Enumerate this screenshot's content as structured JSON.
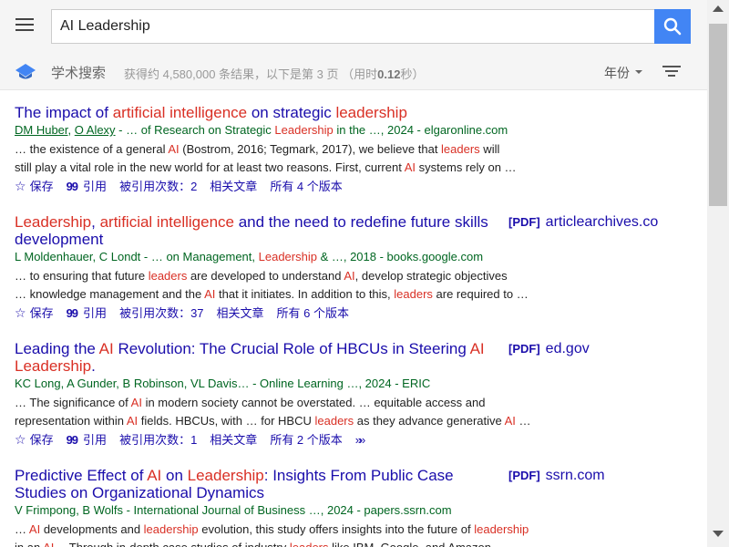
{
  "search": {
    "query": "AI Leadership"
  },
  "subbar": {
    "scholar_label": "学术搜索",
    "stats_prefix": "获得约 4,580,000 条结果，以下是第 3 页 （用时",
    "stats_time": "0.12",
    "stats_suffix": "秒）",
    "year_filter": "年份"
  },
  "colors": {
    "accent": "#4285f4",
    "title_link": "#1a0dab",
    "highlight": "#d93025",
    "meta_green": "#006621"
  },
  "results": [
    {
      "title": [
        {
          "t": "The impact of ",
          "h": false
        },
        {
          "t": "artificial intelligence",
          "h": true
        },
        {
          "t": " on strategic ",
          "h": false
        },
        {
          "t": "leadership",
          "h": true
        }
      ],
      "pdf": null,
      "meta": [
        {
          "t": "DM Huber",
          "k": "author"
        },
        {
          "t": ", ",
          "k": "plain"
        },
        {
          "t": "O Alexy",
          "k": "author"
        },
        {
          "t": " - … of Research on Strategic ",
          "k": "plain"
        },
        {
          "t": "Leadership",
          "k": "hl"
        },
        {
          "t": " in the …, 2024 - elgaronline.com",
          "k": "plain"
        }
      ],
      "snippet": [
        [
          {
            "t": "… the existence of a general ",
            "h": false
          },
          {
            "t": "AI",
            "h": true
          },
          {
            "t": " (Bostrom, 2016; Tegmark, 2017), we believe that ",
            "h": false
          },
          {
            "t": "leaders",
            "h": true
          },
          {
            "t": " will",
            "h": false
          }
        ],
        [
          {
            "t": "still play a vital role in the new world for at least two reasons. First, current ",
            "h": false
          },
          {
            "t": "AI",
            "h": true
          },
          {
            "t": " systems rely on …",
            "h": false
          }
        ]
      ],
      "actions": {
        "save": "保存",
        "cite": "引用",
        "cited_by": "被引用次数：2",
        "related": "相关文章",
        "versions": "所有 4 个版本"
      },
      "more": false
    },
    {
      "title": [
        {
          "t": "Leadership",
          "h": true
        },
        {
          "t": ", ",
          "h": false
        },
        {
          "t": "artificial intelligence",
          "h": true
        },
        {
          "t": " and the need to redefine future skills development",
          "h": false
        }
      ],
      "pdf": {
        "tag": "[PDF]",
        "domain": "articlearchives.co"
      },
      "meta": [
        {
          "t": "L Moldenhauer, C Londt - … on Management, ",
          "k": "plain"
        },
        {
          "t": "Leadership",
          "k": "hl"
        },
        {
          "t": " & …, 2018 - books.google.com",
          "k": "plain"
        }
      ],
      "snippet": [
        [
          {
            "t": "… to ensuring that future ",
            "h": false
          },
          {
            "t": "leaders",
            "h": true
          },
          {
            "t": " are developed to understand ",
            "h": false
          },
          {
            "t": "AI",
            "h": true
          },
          {
            "t": ", develop strategic objectives",
            "h": false
          }
        ],
        [
          {
            "t": "… knowledge management and the ",
            "h": false
          },
          {
            "t": "AI",
            "h": true
          },
          {
            "t": " that it initiates. In addition to this, ",
            "h": false
          },
          {
            "t": "leaders",
            "h": true
          },
          {
            "t": " are required to …",
            "h": false
          }
        ]
      ],
      "actions": {
        "save": "保存",
        "cite": "引用",
        "cited_by": "被引用次数：37",
        "related": "相关文章",
        "versions": "所有 6 个版本"
      },
      "more": false
    },
    {
      "title": [
        {
          "t": "Leading the ",
          "h": false
        },
        {
          "t": "AI",
          "h": true
        },
        {
          "t": " Revolution: The Crucial Role of HBCUs in Steering ",
          "h": false
        },
        {
          "t": "AI",
          "h": true
        },
        {
          "t": " ",
          "h": false
        },
        {
          "t": "Leadership",
          "h": true
        },
        {
          "t": ".",
          "h": false
        }
      ],
      "pdf": {
        "tag": "[PDF]",
        "domain": "ed.gov"
      },
      "meta": [
        {
          "t": "KC Long, A Gunder, B Robinson, VL Davis… - Online Learning …, 2024 - ERIC",
          "k": "plain"
        }
      ],
      "snippet": [
        [
          {
            "t": "… The significance of ",
            "h": false
          },
          {
            "t": "AI",
            "h": true
          },
          {
            "t": " in modern society cannot be overstated. … equitable access and",
            "h": false
          }
        ],
        [
          {
            "t": "representation within ",
            "h": false
          },
          {
            "t": "AI",
            "h": true
          },
          {
            "t": " fields. HBCUs, with … for HBCU ",
            "h": false
          },
          {
            "t": "leaders",
            "h": true
          },
          {
            "t": " as they advance generative ",
            "h": false
          },
          {
            "t": "AI",
            "h": true
          },
          {
            "t": " …",
            "h": false
          }
        ]
      ],
      "actions": {
        "save": "保存",
        "cite": "引用",
        "cited_by": "被引用次数：1",
        "related": "相关文章",
        "versions": "所有 2 个版本"
      },
      "more": true
    },
    {
      "title": [
        {
          "t": "Predictive Effect of ",
          "h": false
        },
        {
          "t": "AI",
          "h": true
        },
        {
          "t": " on ",
          "h": false
        },
        {
          "t": "Leadership",
          "h": true
        },
        {
          "t": ": Insights From Public Case Studies on Organizational Dynamics",
          "h": false
        }
      ],
      "pdf": {
        "tag": "[PDF]",
        "domain": "ssrn.com"
      },
      "meta": [
        {
          "t": "V Frimpong, B Wolfs - International Journal of Business …, 2024 - papers.ssrn.com",
          "k": "plain"
        }
      ],
      "snippet": [
        [
          {
            "t": "… ",
            "h": false
          },
          {
            "t": "AI",
            "h": true
          },
          {
            "t": " developments and ",
            "h": false
          },
          {
            "t": "leadership",
            "h": true
          },
          {
            "t": " evolution, this study offers insights into the future of ",
            "h": false
          },
          {
            "t": "leadership",
            "h": true
          }
        ],
        [
          {
            "t": "in an ",
            "h": false
          },
          {
            "t": "AI",
            "h": true
          },
          {
            "t": "… Through in-depth case studies of industry ",
            "h": false
          },
          {
            "t": "leaders",
            "h": true
          },
          {
            "t": " like IBM, Google, and Amazon,",
            "h": false
          }
        ]
      ],
      "actions": null,
      "more": false
    }
  ]
}
